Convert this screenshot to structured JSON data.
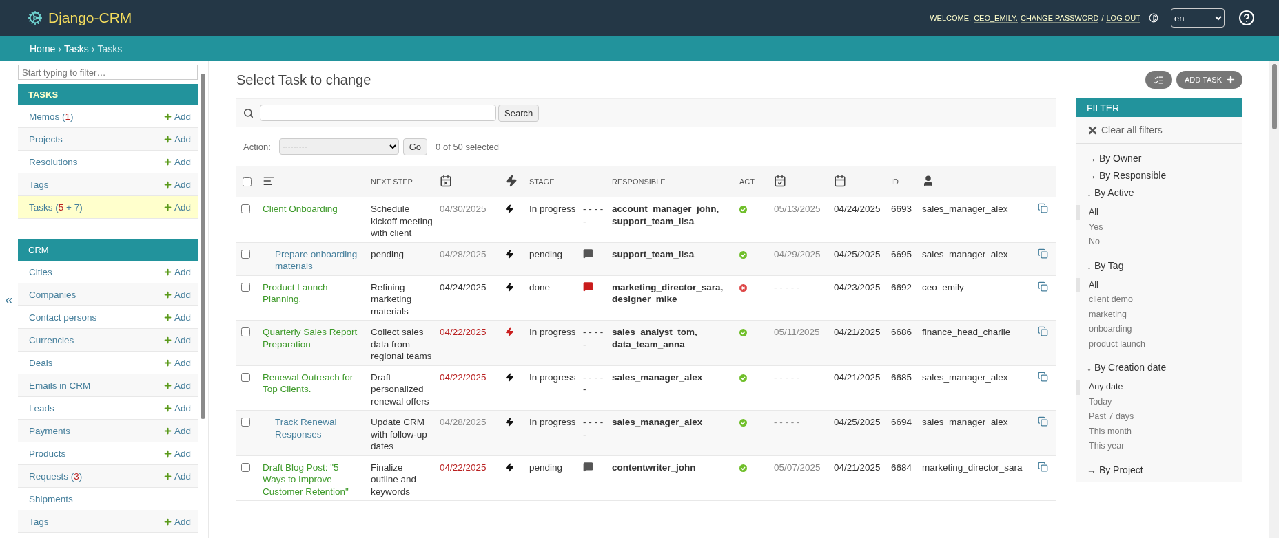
{
  "header": {
    "logo": "Django-CRM",
    "welcome": "WELCOME,",
    "user": "CEO_EMILY.",
    "change_password": "CHANGE PASSWORD",
    "separator": "/",
    "logout": "LOG OUT",
    "language": "en"
  },
  "breadcrumbs": {
    "separator": "›",
    "items": [
      "Home",
      "Tasks",
      "Tasks"
    ]
  },
  "sidebar": {
    "collapse": "«",
    "filter_placeholder": "Start typing to filter…",
    "sections": [
      {
        "title": "TASKS",
        "current": true,
        "items": [
          {
            "label": "Memos",
            "count": [
              {
                "text": " (",
                "alert": false
              },
              {
                "text": "1",
                "alert": true
              },
              {
                "text": ")",
                "alert": false
              }
            ],
            "add": "Add",
            "selected": false
          },
          {
            "label": "Projects",
            "add": "Add",
            "selected": false
          },
          {
            "label": "Resolutions",
            "add": "Add",
            "selected": false
          },
          {
            "label": "Tags",
            "add": "Add",
            "selected": false
          },
          {
            "label": "Tasks",
            "count": [
              {
                "text": " (",
                "alert": false
              },
              {
                "text": "5",
                "alert": true
              },
              {
                "text": " + 7)",
                "alert": false
              }
            ],
            "add": "Add",
            "selected": true
          }
        ]
      },
      {
        "title": "CRM",
        "current": false,
        "items": [
          {
            "label": "Cities",
            "add": "Add",
            "selected": false
          },
          {
            "label": "Companies",
            "add": "Add",
            "selected": false
          },
          {
            "label": "Contact persons",
            "add": "Add",
            "selected": false
          },
          {
            "label": "Currencies",
            "add": "Add",
            "selected": false
          },
          {
            "label": "Deals",
            "add": "Add",
            "selected": false
          },
          {
            "label": "Emails in CRM",
            "add": "Add",
            "selected": false
          },
          {
            "label": "Leads",
            "add": "Add",
            "selected": false
          },
          {
            "label": "Payments",
            "add": "Add",
            "selected": false
          },
          {
            "label": "Products",
            "add": "Add",
            "selected": false
          },
          {
            "label": "Requests",
            "count": [
              {
                "text": " (",
                "alert": false
              },
              {
                "text": "3",
                "alert": true
              },
              {
                "text": ")",
                "alert": false
              }
            ],
            "add": "Add",
            "selected": false
          },
          {
            "label": "Shipments",
            "selected": false
          },
          {
            "label": "Tags",
            "add": "Add",
            "selected": false
          }
        ]
      }
    ]
  },
  "main": {
    "title": "Select Task to change",
    "add_button": "ADD TASK",
    "search_button": "Search",
    "action_label": "Action:",
    "action_value": "---------",
    "go_button": "Go",
    "counter": "0 of 50 selected"
  },
  "table": {
    "columns": [
      {
        "kind": "checkbox",
        "checked": false
      },
      {
        "kind": "icon"
      },
      {
        "kind": "text",
        "label": "NEXT STEP"
      },
      {
        "kind": "icon"
      },
      {
        "kind": "icon"
      },
      {
        "kind": "text",
        "label": "STAGE"
      },
      {
        "kind": "blank"
      },
      {
        "kind": "text",
        "label": "RESPONSIBLE"
      },
      {
        "kind": "text",
        "label": "ACT"
      },
      {
        "kind": "icon"
      },
      {
        "kind": "icon"
      },
      {
        "kind": "text",
        "label": "ID"
      },
      {
        "kind": "icon"
      },
      {
        "kind": "blank"
      }
    ],
    "rows": [
      {
        "selected": false,
        "title": "Client Onboarding",
        "subtask": false,
        "next_step": "Schedule kickoff meeting with client",
        "due": "04/30/2025",
        "overdue": false,
        "greyed": true,
        "urgent": false,
        "stage": "In progress",
        "marker": {
          "kind": "dashes",
          "text": "- - - - -"
        },
        "responsible": "account_manager_john, support_team_lisa",
        "active": true,
        "next_date": "05/13/2025",
        "created": "04/24/2025",
        "id": "6693",
        "owner": "sales_manager_alex"
      },
      {
        "selected": false,
        "title": "Prepare onboarding materials",
        "subtask": true,
        "next_step": "pending",
        "due": "04/28/2025",
        "overdue": false,
        "greyed": true,
        "urgent": false,
        "stage": "pending",
        "marker": {
          "kind": "chat"
        },
        "responsible": "support_team_lisa",
        "active": true,
        "next_date": "04/29/2025",
        "created": "04/25/2025",
        "id": "6695",
        "owner": "sales_manager_alex"
      },
      {
        "selected": false,
        "title": "Product Launch Planning.",
        "subtask": false,
        "next_step": "Refining marketing materials",
        "due": "04/24/2025",
        "overdue": false,
        "greyed": false,
        "urgent": false,
        "stage": "done",
        "marker": {
          "kind": "chat_alert"
        },
        "responsible": "marketing_director_sara, designer_mike",
        "active": false,
        "next_date": "- - - - -",
        "created": "04/23/2025",
        "id": "6692",
        "owner": "ceo_emily"
      },
      {
        "selected": false,
        "title": "Quarterly Sales Report Preparation",
        "subtask": false,
        "next_step": "Collect sales data from regional teams",
        "due": "04/22/2025",
        "overdue": true,
        "urgent": true,
        "stage": "In progress",
        "marker": {
          "kind": "dashes",
          "text": "- - - - -"
        },
        "responsible": "sales_analyst_tom, data_team_anna",
        "active": true,
        "next_date": "05/11/2025",
        "created": "04/21/2025",
        "id": "6686",
        "owner": "finance_head_charlie"
      },
      {
        "selected": false,
        "title": "Renewal Outreach for Top Clients.",
        "subtask": false,
        "next_step": "Draft personalized renewal offers",
        "due": "04/22/2025",
        "overdue": true,
        "urgent": false,
        "stage": "In progress",
        "marker": {
          "kind": "dashes",
          "text": "- - - - -"
        },
        "responsible": "sales_manager_alex",
        "active": true,
        "next_date": "- - - - -",
        "created": "04/21/2025",
        "id": "6685",
        "owner": "sales_manager_alex"
      },
      {
        "selected": false,
        "title": "Track Renewal Responses",
        "subtask": true,
        "next_step": "Update CRM with follow-up dates",
        "due": "04/28/2025",
        "overdue": false,
        "greyed": true,
        "urgent": false,
        "stage": "In progress",
        "marker": {
          "kind": "dashes",
          "text": "- - - - -"
        },
        "responsible": "sales_manager_alex",
        "active": true,
        "next_date": "- - - - -",
        "created": "04/25/2025",
        "id": "6694",
        "owner": "sales_manager_alex"
      },
      {
        "selected": false,
        "title": "Draft Blog Post: \"5 Ways to Improve Customer Retention\"",
        "subtask": false,
        "next_step": "Finalize outline and keywords",
        "due": "04/22/2025",
        "overdue": true,
        "urgent": false,
        "stage": "pending",
        "marker": {
          "kind": "chat"
        },
        "responsible": "contentwriter_john",
        "active": true,
        "next_date": "05/07/2025",
        "created": "04/21/2025",
        "id": "6684",
        "owner": "marketing_director_sara"
      }
    ]
  },
  "filter": {
    "title": "FILTER",
    "clear": "Clear all filters",
    "groups": [
      {
        "arrow": "→",
        "title": "By Owner"
      },
      {
        "arrow": "→",
        "title": "By Responsible"
      },
      {
        "arrow": "↓",
        "title": "By Active",
        "expanded": true,
        "options": [
          {
            "label": "All",
            "selected": true
          },
          {
            "label": "Yes",
            "selected": false
          },
          {
            "label": "No",
            "selected": false
          }
        ]
      },
      {
        "arrow": "↓",
        "title": "By Tag",
        "expanded": true,
        "options": [
          {
            "label": "All",
            "selected": true
          },
          {
            "label": "client demo",
            "selected": false
          },
          {
            "label": "marketing",
            "selected": false
          },
          {
            "label": "onboarding",
            "selected": false
          },
          {
            "label": "product launch",
            "selected": false
          }
        ]
      },
      {
        "arrow": "↓",
        "title": "By Creation date",
        "expanded": true,
        "options": [
          {
            "label": "Any date",
            "selected": true
          },
          {
            "label": "Today",
            "selected": false
          },
          {
            "label": "Past 7 days",
            "selected": false
          },
          {
            "label": "This month",
            "selected": false
          },
          {
            "label": "This year",
            "selected": false
          }
        ]
      },
      {
        "arrow": "→",
        "title": "By Project"
      }
    ]
  }
}
